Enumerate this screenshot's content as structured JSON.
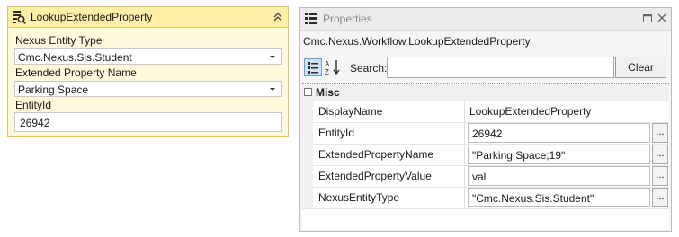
{
  "activity": {
    "title": "LookupExtendedProperty",
    "icon": "lookup-property-icon",
    "fields": {
      "entity_type_label": "Nexus Entity Type",
      "entity_type_value": "Cmc.Nexus.Sis.Student",
      "property_name_label": "Extended Property Name",
      "property_name_value": "Parking Space",
      "entity_id_label": "EntityId",
      "entity_id_value": "26942"
    },
    "colors": {
      "border": "#e5c65c",
      "header": "#fff0a8",
      "body": "#fff9dc"
    }
  },
  "properties": {
    "title": "Properties",
    "type_name": "Cmc.Nexus.Workflow.LookupExtendedProperty",
    "toolbar": {
      "categorized_icon": "categorized-view-icon",
      "alphabetical_icon": "sort-alphabetical-icon",
      "search_label": "Search:",
      "search_value": "",
      "clear_label": "Clear"
    },
    "category": "Misc",
    "rows": [
      {
        "name": "DisplayName",
        "value": "LookupExtendedProperty",
        "editable": false
      },
      {
        "name": "EntityId",
        "value": "26942",
        "editable": true
      },
      {
        "name": "ExtendedPropertyName",
        "value": "\"Parking Space;19\"",
        "editable": true
      },
      {
        "name": "ExtendedPropertyValue",
        "value": "val",
        "editable": true
      },
      {
        "name": "NexusEntityType",
        "value": "\"Cmc.Nexus.Sis.Student\"",
        "editable": true
      }
    ],
    "ellipsis_label": "..."
  }
}
